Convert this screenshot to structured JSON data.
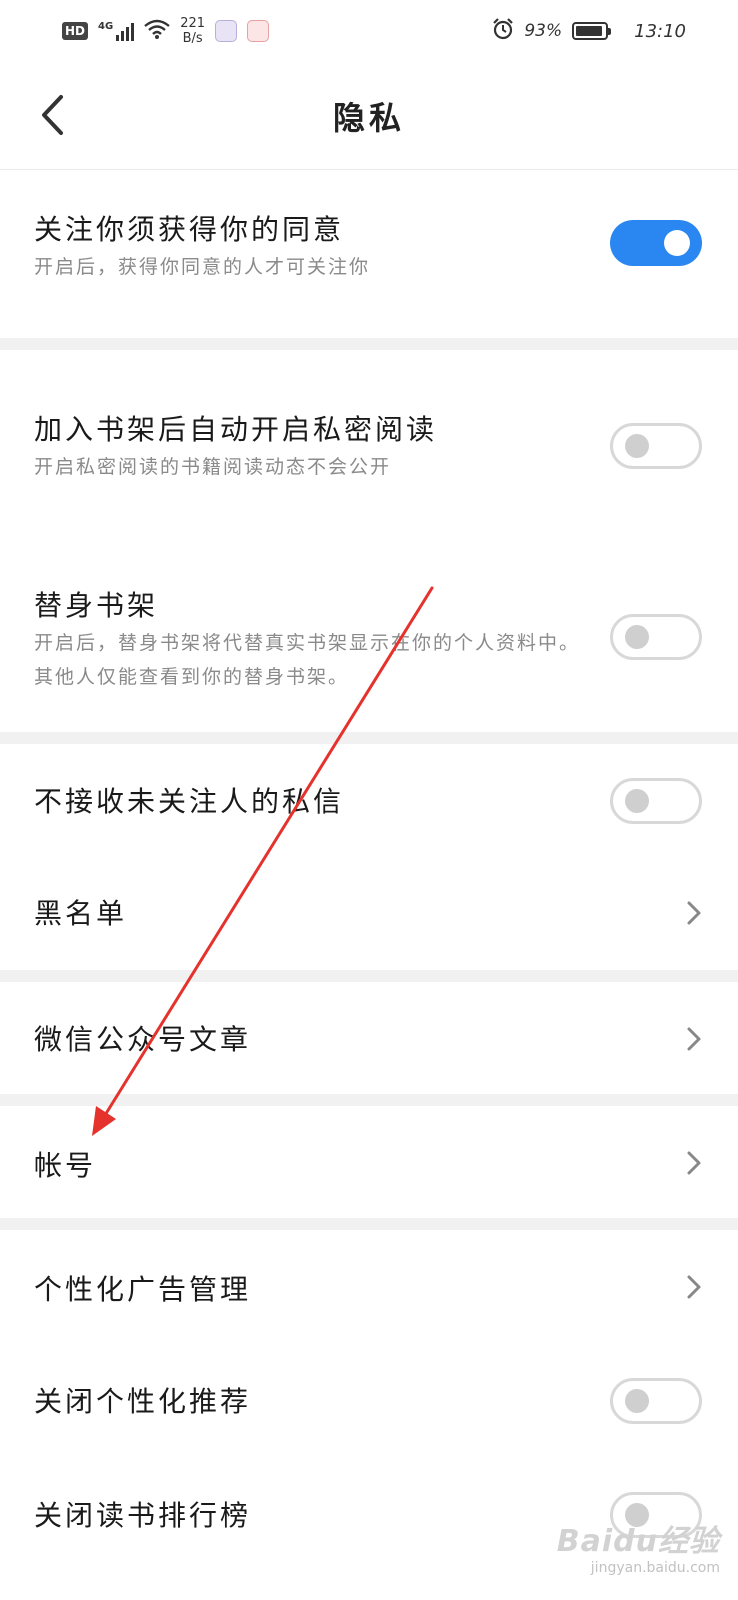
{
  "status_bar": {
    "hd": "HD",
    "network": "4G",
    "speed_value": "221",
    "speed_unit": "B/s",
    "battery_text": "93%",
    "battery_level": 0.93,
    "time": "13:10",
    "icons": [
      "hd-icon",
      "signal-icon",
      "wifi-icon",
      "app-icon-1",
      "app-icon-2",
      "alarm-icon",
      "battery-icon"
    ]
  },
  "header": {
    "title": "隐私",
    "back_icon": "chevron-left-icon"
  },
  "settings": {
    "follow_consent": {
      "title": "关注你须获得你的同意",
      "desc": "开启后，获得你同意的人才可关注你",
      "enabled": true
    },
    "private_reading": {
      "title": "加入书架后自动开启私密阅读",
      "desc": "开启私密阅读的书籍阅读动态不会公开",
      "enabled": false
    },
    "proxy_shelf": {
      "title": "替身书架",
      "desc": "开启后，替身书架将代替真实书架显示在你的个人资料中。其他人仅能查看到你的替身书架。",
      "enabled": false
    },
    "no_dm_strangers": {
      "title": "不接收未关注人的私信",
      "enabled": false
    },
    "blacklist": {
      "title": "黑名单"
    },
    "wechat_articles": {
      "title": "微信公众号文章"
    },
    "account": {
      "title": "帐号"
    },
    "ad_management": {
      "title": "个性化广告管理"
    },
    "disable_recommend": {
      "title": "关闭个性化推荐",
      "enabled": false
    },
    "disable_ranking": {
      "title": "关闭读书排行榜",
      "enabled": false
    }
  },
  "colors": {
    "toggle_on": "#2a86f0",
    "toggle_off_border": "#d8d8d8",
    "divider": "#f1f1f1",
    "annotation_arrow": "#e5322d"
  },
  "watermark": {
    "brand": "Baidu经验",
    "site": "jingyan.baidu.com"
  }
}
